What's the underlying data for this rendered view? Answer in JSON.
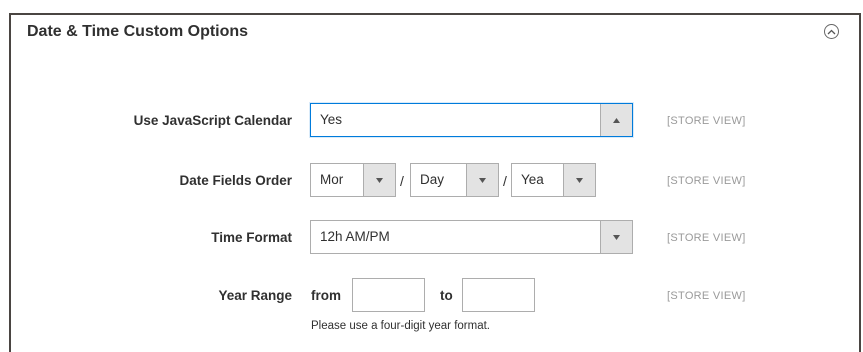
{
  "section": {
    "title": "Date & Time Custom Options"
  },
  "fields": {
    "calendar": {
      "label": "Use JavaScript Calendar",
      "value": "Yes",
      "scope": "[STORE VIEW]"
    },
    "date_order": {
      "label": "Date Fields Order",
      "month_value": "Mor",
      "day_value": "Day",
      "year_value": "Yea",
      "separator": "/",
      "scope": "[STORE VIEW]"
    },
    "time_format": {
      "label": "Time Format",
      "value": "12h AM/PM",
      "scope": "[STORE VIEW]"
    },
    "year_range": {
      "label": "Year Range",
      "from_label": "from",
      "to_label": "to",
      "from_value": "",
      "to_value": "",
      "note": "Please use a four-digit year format.",
      "scope": "[STORE VIEW]"
    }
  },
  "icons": {
    "collapse": "chevron-up-circle-icon",
    "dropdown_open": "caret-up-icon",
    "dropdown": "caret-down-icon"
  },
  "colors": {
    "focus_border": "#007bdb",
    "arrow_bg": "#e3e3e3",
    "scope_text": "#9a9a9a",
    "panel_border": "#4a4542"
  }
}
